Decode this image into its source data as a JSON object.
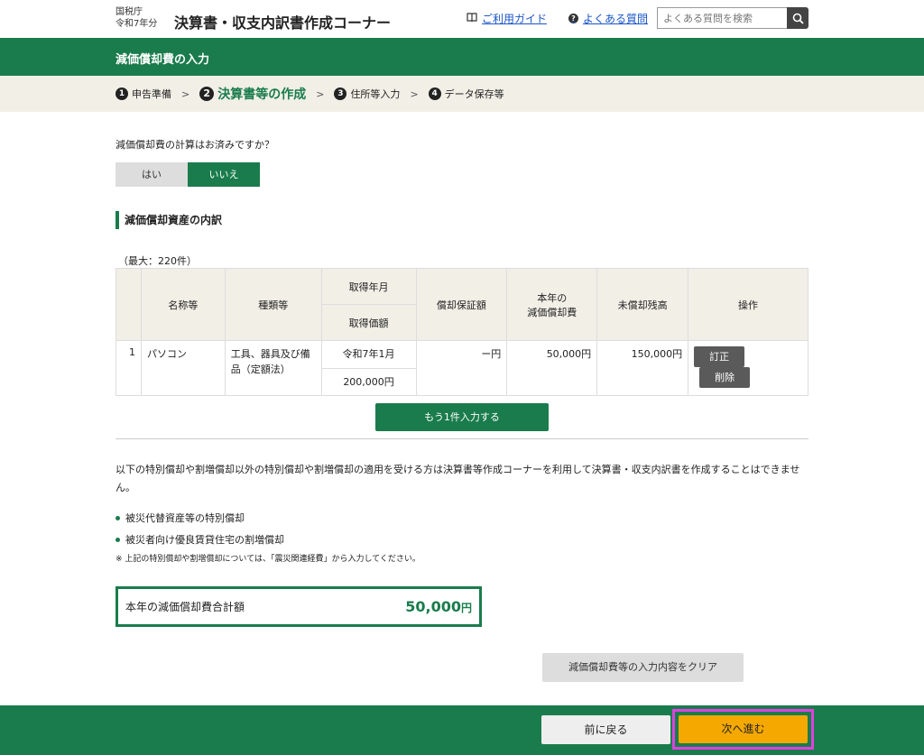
{
  "header": {
    "agency_line1": "国税庁",
    "agency_line2": "令和7年分",
    "title": "決算書・収支内訳書作成コーナー",
    "guide_link": "ご利用ガイド",
    "faq_link": "よくある質問",
    "search_placeholder": "よくある質問を検索"
  },
  "page_title": "減価償却費の入力",
  "steps": [
    {
      "num": "1",
      "label": "申告準備"
    },
    {
      "num": "2",
      "label": "決算書等の作成"
    },
    {
      "num": "3",
      "label": "住所等入力"
    },
    {
      "num": "4",
      "label": "データ保存等"
    }
  ],
  "question": {
    "text": "減価償却費の計算はお済みですか？",
    "yes": "はい",
    "no": "いいえ",
    "selected": "いいえ"
  },
  "section_title": "減価償却資産の内訳",
  "max_note": "（最大：220件）",
  "table": {
    "headers": {
      "name": "名称等",
      "type": "種類等",
      "acq_date": "取得年月",
      "acq_price": "取得価額",
      "guarantee": "償却保証額",
      "current_l1": "本年の",
      "current_l2": "減価償却費",
      "remaining": "未償却残高",
      "ops": "操作"
    },
    "rows": [
      {
        "no": "1",
        "name": "パソコン",
        "type_l1": "工具、器具及び備",
        "type_l2": "品（定額法）",
        "acq_date": "令和7年1月",
        "acq_price": "200,000円",
        "guarantee": "ー円",
        "current": "50,000円",
        "remaining": "150,000円",
        "edit": "訂正",
        "delete": "削除"
      }
    ]
  },
  "add_button": "もう1件入力する",
  "notice": "以下の特別償却や割増償却以外の特別償却や割増償却の適用を受ける方は決算書等作成コーナーを利用して決算書・収支内訳書を作成することはできません。",
  "bullets": [
    "被災代替資産等の特別償却",
    "被災者向け優良賃貸住宅の割増償却"
  ],
  "footnote": "※ 上記の特別償却や割増償却については、「震災関連経費」から入力してください。",
  "total": {
    "label": "本年の減価償却費合計額",
    "value": "50,000",
    "unit": "円"
  },
  "clear_button": "減価償却費等の入力内容をクリア",
  "footer": {
    "back": "前に戻る",
    "next": "次へ進む"
  },
  "colors": {
    "primary": "#1a7c4c",
    "next": "#f5a800",
    "highlight": "#e040e0"
  }
}
